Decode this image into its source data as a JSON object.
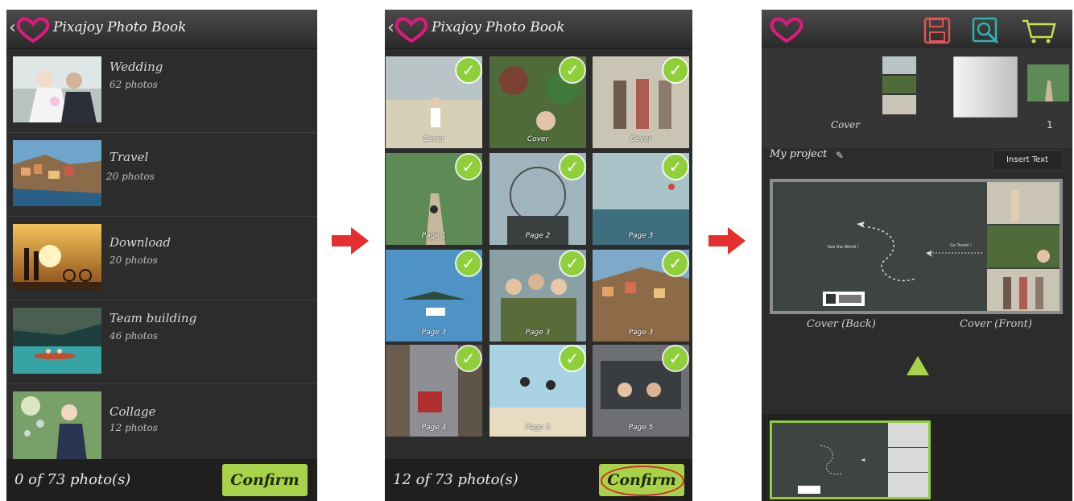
{
  "colors": {
    "accent_green": "#a7d24a",
    "check_green": "#8fcf3a",
    "arrow_red": "#e52e2e",
    "logo_pink": "#e0197d"
  },
  "screen1": {
    "title": "Pixajoy Photo Book",
    "albums": [
      {
        "name": "Wedding",
        "count": "62 photos"
      },
      {
        "name": "Travel",
        "count": "20 photos"
      },
      {
        "name": "Download",
        "count": "20 photos"
      },
      {
        "name": "Team building",
        "count": "46 photos"
      },
      {
        "name": "Collage",
        "count": "12 photos"
      }
    ],
    "status": "0 of 73 photo(s)",
    "confirm": "Confirm"
  },
  "screen2": {
    "title": "Pixajoy Photo Book",
    "tiles": [
      "Cover",
      "Cover",
      "Cover",
      "Page 1",
      "Page 2",
      "Page 3",
      "Page 3",
      "Page 3",
      "Page 3",
      "Page 4",
      "Page 5",
      "Page 5"
    ],
    "status": "12 of 73 photo(s)",
    "confirm": "Confirm"
  },
  "screen3": {
    "toolbar_icons": [
      "save-icon",
      "preview-icon",
      "cart-icon"
    ],
    "cover_label": "Cover",
    "page_number": "1",
    "project_name": "My project",
    "insert_text": "Insert Text",
    "spread_text_left": "See the World !",
    "spread_text_right": "Go Travel !",
    "cover_back": "Cover (Back)",
    "cover_front": "Cover (Front)"
  }
}
